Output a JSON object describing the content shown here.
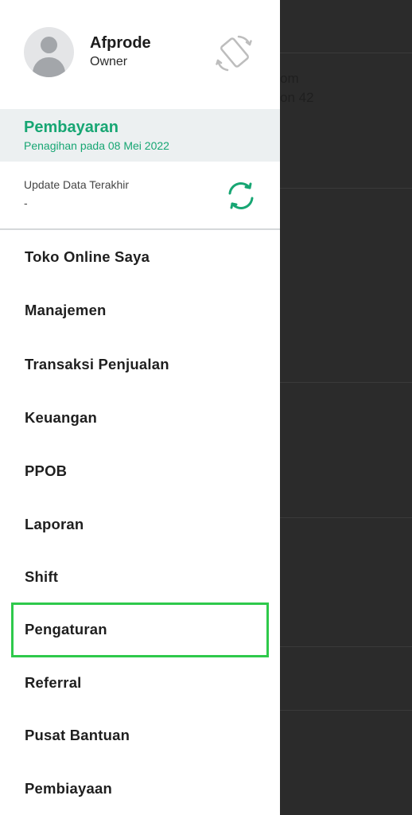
{
  "background": {
    "text_line1": "om",
    "text_line2": "on 42"
  },
  "profile": {
    "name": "Afprode",
    "role": "Owner",
    "rotate_icon": "rotate-device-icon",
    "avatar_icon": "user-avatar-icon"
  },
  "payment": {
    "title": "Pembayaran",
    "subtitle": "Penagihan pada 08 Mei 2022"
  },
  "update": {
    "label": "Update Data Terakhir",
    "value": "-",
    "sync_icon": "sync-icon"
  },
  "menu": {
    "items": [
      {
        "label": "Toko Online Saya"
      },
      {
        "label": "Manajemen"
      },
      {
        "label": "Transaksi Penjualan"
      },
      {
        "label": "Keuangan"
      },
      {
        "label": "PPOB"
      },
      {
        "label": "Laporan"
      },
      {
        "label": "Shift"
      },
      {
        "label": "Pengaturan"
      },
      {
        "label": "Referral"
      },
      {
        "label": "Pusat Bantuan"
      },
      {
        "label": "Pembiayaan"
      }
    ],
    "highlighted_index": 7
  },
  "colors": {
    "accent": "#17a673",
    "highlight_border": "#2ec94b",
    "overlay": "#2b2b2b"
  }
}
